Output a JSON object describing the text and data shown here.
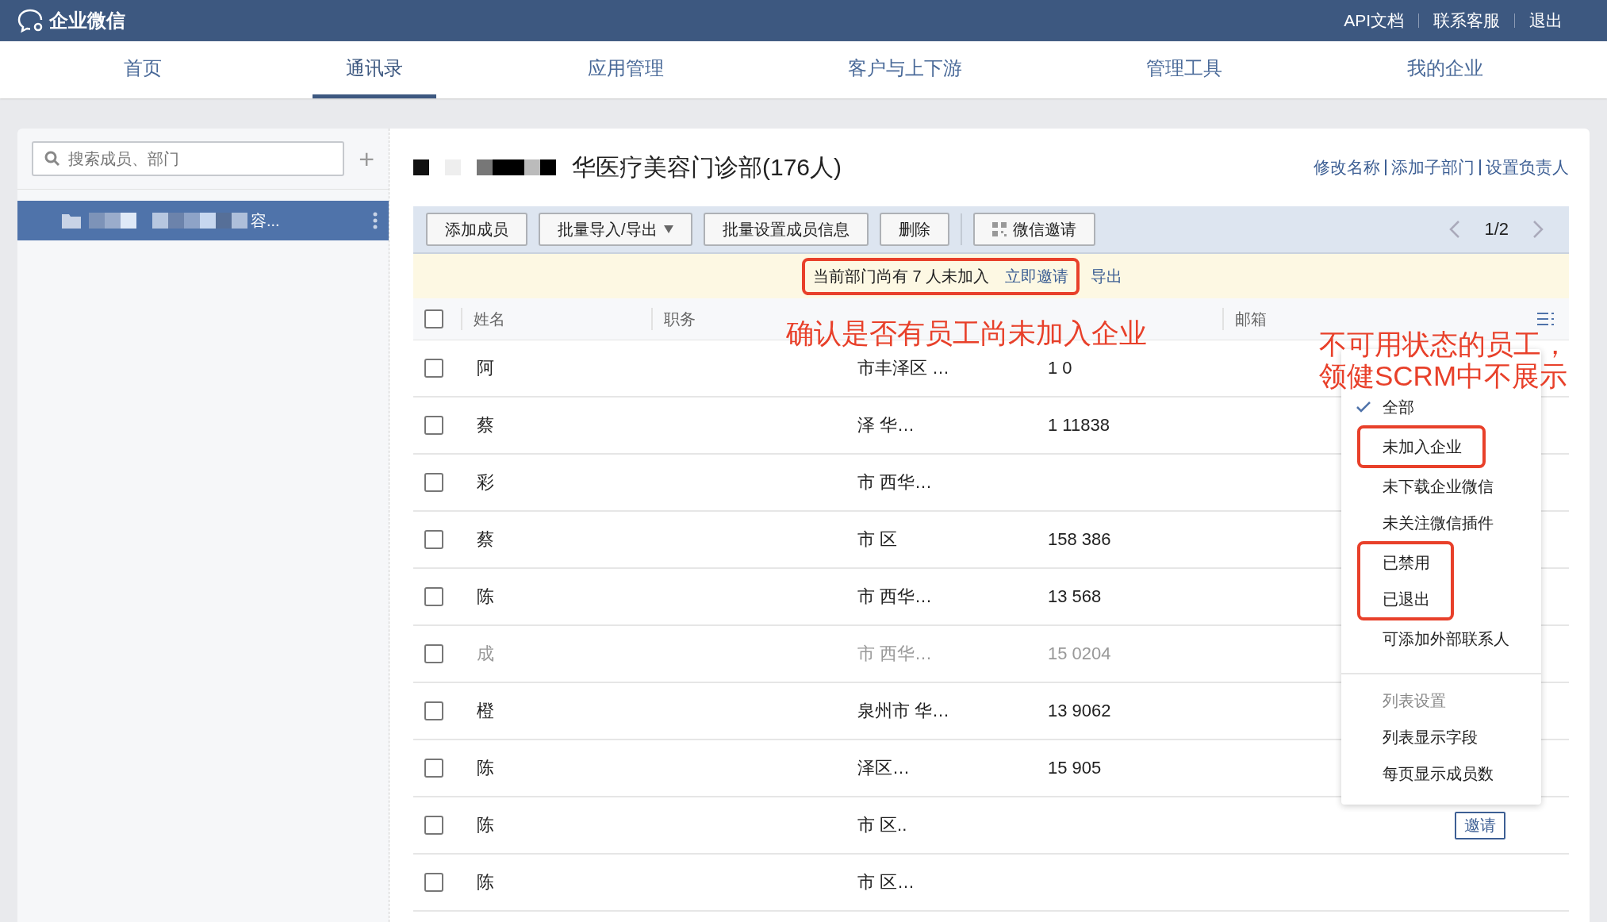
{
  "topbar": {
    "logo": "企业微信",
    "links": [
      "API文档",
      "联系客服",
      "退出"
    ]
  },
  "nav": [
    {
      "label": "首页",
      "selected": false
    },
    {
      "label": "通讯录",
      "selected": true
    },
    {
      "label": "应用管理",
      "selected": false
    },
    {
      "label": "客户与上下游",
      "selected": false
    },
    {
      "label": "管理工具",
      "selected": false
    },
    {
      "label": "我的企业",
      "selected": false
    }
  ],
  "sidebar": {
    "search": {
      "placeholder": "搜索成员、部门"
    },
    "add": "+",
    "departments": [
      {
        "label": "容...",
        "selected": true
      }
    ]
  },
  "department": {
    "title": "华医疗美容门诊部(176人)",
    "actions": [
      "修改名称",
      "添加子部门",
      "设置负责人"
    ]
  },
  "toolbar": {
    "buttons": [
      {
        "label": "添加成员",
        "kind": "plain"
      },
      {
        "label": "批量导入/导出",
        "kind": "dropdown"
      },
      {
        "label": "批量设置成员信息",
        "kind": "plain"
      },
      {
        "label": "删除",
        "kind": "plain"
      },
      {
        "label": "微信邀请",
        "kind": "qr"
      }
    ],
    "page": "1/2"
  },
  "notice": {
    "text": "当前部门尚有 7 人未加入",
    "invite": "立即邀请",
    "export": "导出",
    "highlighted": true
  },
  "table": {
    "select_all": {
      "checked": false
    },
    "columns": {
      "name": "姓名",
      "title": "职务",
      "email": "邮箱"
    },
    "rows": [
      {
        "name": "阿",
        "department": "市丰泽区 …",
        "phone": "1 0",
        "disabled": false
      },
      {
        "name": "蔡",
        "department": "泽 华…",
        "phone": "1 11838",
        "disabled": false
      },
      {
        "name": "彩",
        "department": "市 西华…",
        "phone": "",
        "disabled": false
      },
      {
        "name": "蔡",
        "department": "市 区",
        "phone": "158 386",
        "disabled": false
      },
      {
        "name": "陈",
        "department": "市 西华…",
        "phone": "13 568",
        "disabled": false
      },
      {
        "name": "成",
        "department": "市 西华…",
        "phone": "15 0204",
        "disabled": true
      },
      {
        "name": "橙",
        "department": "泉州市 华…",
        "phone": "13 9062",
        "disabled": false
      },
      {
        "name": "陈",
        "department": "泽区…",
        "phone": "15 905",
        "disabled": false
      },
      {
        "name": "陈",
        "department": "市 区..",
        "phone": "",
        "disabled": false,
        "action": "邀请"
      },
      {
        "name": "陈",
        "department": "市 区…",
        "phone": "",
        "disabled": false
      }
    ]
  },
  "filter_menu": {
    "items": [
      {
        "label": "全部",
        "selected": true,
        "highlighted": false
      },
      {
        "label": "未加入企业",
        "selected": false,
        "highlighted": true
      },
      {
        "label": "未下载企业微信",
        "selected": false,
        "highlighted": false
      },
      {
        "label": "未关注微信插件",
        "selected": false,
        "highlighted": false
      },
      {
        "label": "已禁用",
        "selected": false,
        "highlighted": true
      },
      {
        "label": "已退出",
        "selected": false,
        "highlighted": true
      },
      {
        "label": "可添加外部联系人",
        "selected": false,
        "highlighted": false
      }
    ],
    "section_title": "列表设置",
    "settings": [
      "列表显示字段",
      "每页显示成员数"
    ]
  },
  "annotations": [
    {
      "lines": [
        "确认是否有员工尚未加入企业"
      ]
    },
    {
      "lines": [
        "不可用状态的员工，",
        "领健SCRM中不展示"
      ]
    }
  ]
}
